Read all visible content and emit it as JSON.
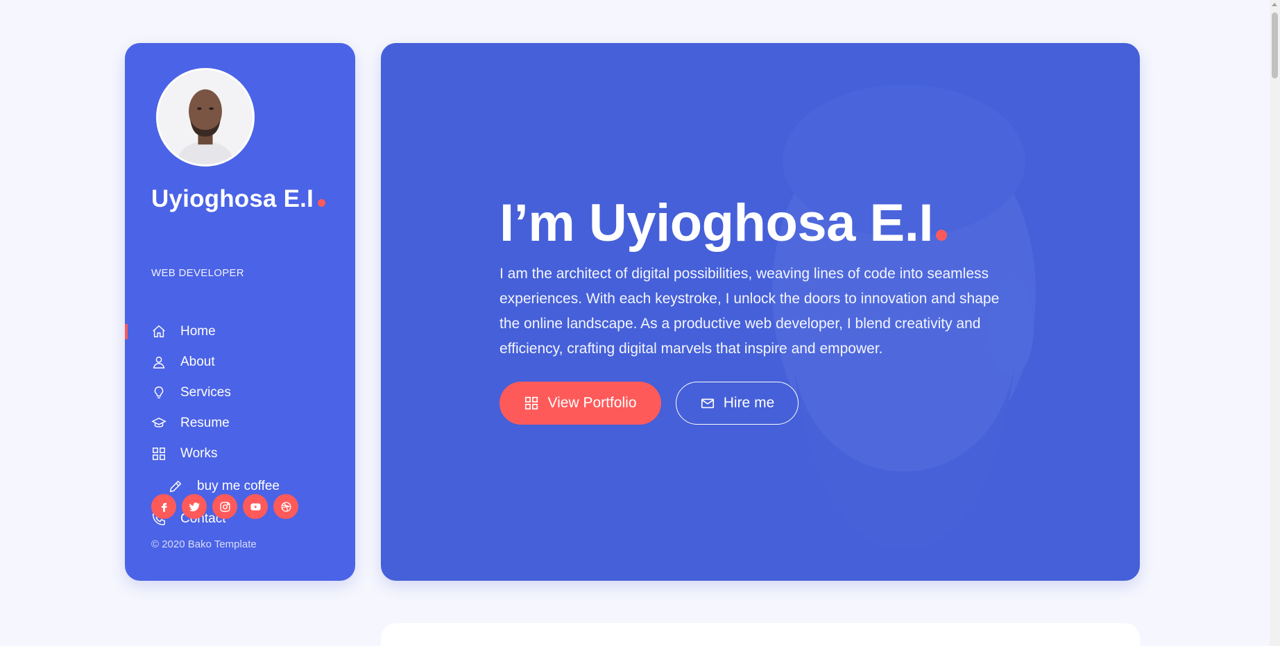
{
  "sidebar": {
    "name": "Uyioghosa E.I",
    "role": "WEB DEVELOPER",
    "nav": [
      {
        "label": "Home",
        "icon": "home-icon",
        "active": true
      },
      {
        "label": "About",
        "icon": "user-icon"
      },
      {
        "label": "Services",
        "icon": "bulb-icon"
      },
      {
        "label": "Resume",
        "icon": "graduation-cap-icon"
      },
      {
        "label": "Works",
        "icon": "grid-icon"
      },
      {
        "label": "buy me coffee",
        "icon": "pencil-icon"
      },
      {
        "label": "Contact",
        "icon": "phone-icon"
      }
    ],
    "socials": [
      "facebook-icon",
      "twitter-icon",
      "instagram-icon",
      "youtube-icon",
      "dribbble-icon"
    ],
    "copyright": "© 2020 Bako Template"
  },
  "hero": {
    "title": "I’m Uyioghosa E.I",
    "text": "I am the architect of digital possibilities, weaving lines of code into seamless experiences. With each keystroke, I unlock the doors to innovation and shape the online landscape. As a productive web developer, I blend creativity and efficiency, crafting digital marvels that inspire and empower.",
    "btn_portfolio": "View Portfolio",
    "btn_hire": "Hire me"
  },
  "colors": {
    "sidebar_bg": "#4b63e6",
    "hero_bg": "#4560d8",
    "accent": "#ff5a5a",
    "page_bg": "#f6f7fe"
  }
}
